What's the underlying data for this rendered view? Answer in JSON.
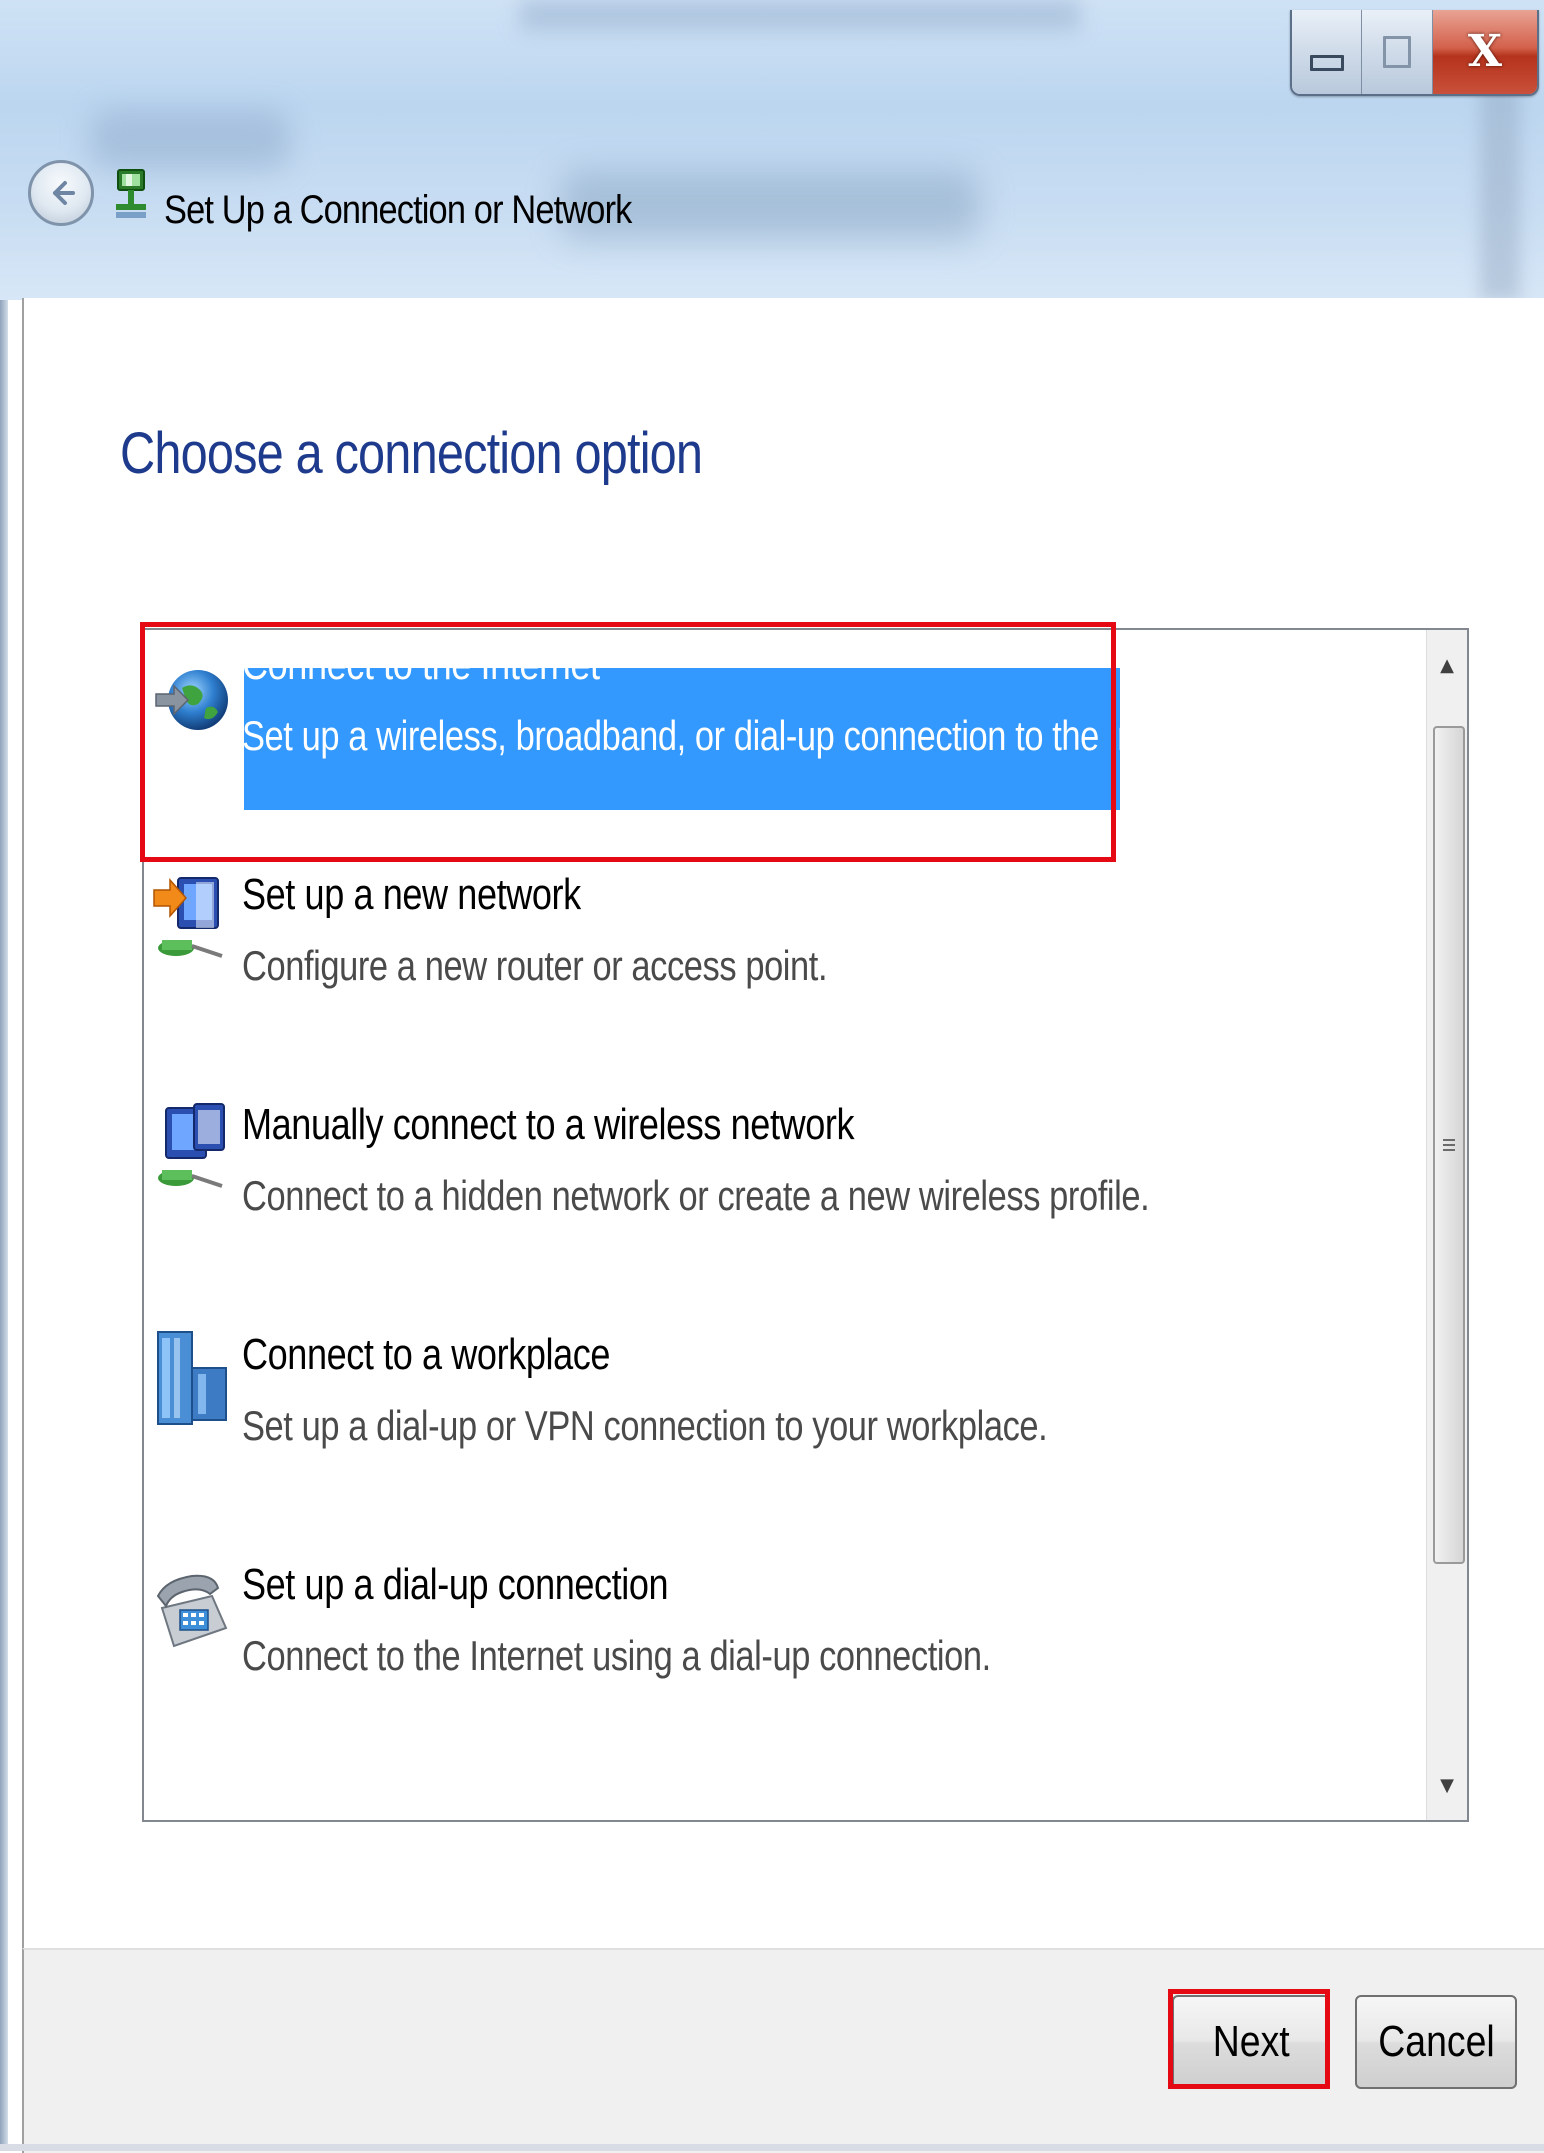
{
  "window": {
    "title": "Set Up a Connection or Network",
    "buttons": {
      "minimize": "minimize",
      "maximize": "maximize",
      "close": "X"
    }
  },
  "heading": "Choose a connection option",
  "options": [
    {
      "title": "Connect to the Internet",
      "description": "Set up a wireless, broadband, or dial-up connection to the Internet.",
      "icon": "globe-icon",
      "selected": true
    },
    {
      "title": "Set up a new network",
      "description": "Configure a new router or access point.",
      "icon": "new-network-icon",
      "selected": false
    },
    {
      "title": "Manually connect to a wireless network",
      "description": "Connect to a hidden network or create a new wireless profile.",
      "icon": "wireless-network-icon",
      "selected": false
    },
    {
      "title": "Connect to a workplace",
      "description": "Set up a dial-up or VPN connection to your workplace.",
      "icon": "workplace-icon",
      "selected": false
    },
    {
      "title": "Set up a dial-up connection",
      "description": "Connect to the Internet using a dial-up connection.",
      "icon": "phone-icon",
      "selected": false
    }
  ],
  "footer": {
    "next_label": "Next",
    "cancel_label": "Cancel"
  },
  "colors": {
    "heading": "#1e3a8c",
    "selection": "#3399ff",
    "highlight_annotation": "#e50914"
  }
}
